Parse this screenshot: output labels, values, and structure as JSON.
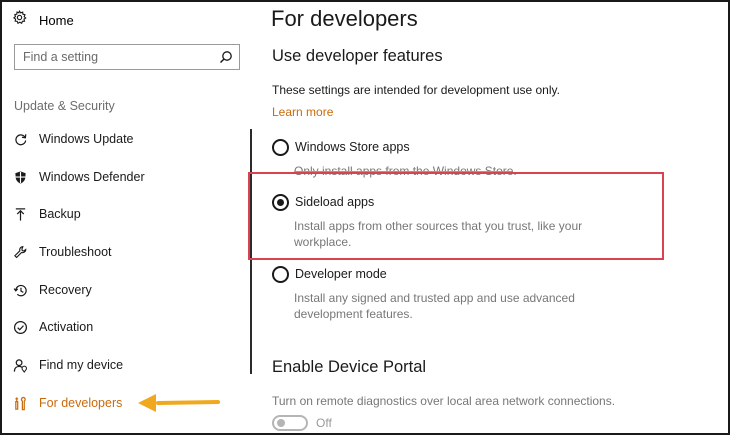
{
  "sidebar": {
    "home_label": "Home",
    "search_placeholder": "Find a setting",
    "section_label": "Update & Security",
    "items": [
      {
        "label": "Windows Update",
        "icon": "refresh-icon"
      },
      {
        "label": "Windows Defender",
        "icon": "shield-icon"
      },
      {
        "label": "Backup",
        "icon": "upload-icon"
      },
      {
        "label": "Troubleshoot",
        "icon": "wrench-icon"
      },
      {
        "label": "Recovery",
        "icon": "history-icon"
      },
      {
        "label": "Activation",
        "icon": "check-circle-icon"
      },
      {
        "label": "Find my device",
        "icon": "person-pin-icon"
      },
      {
        "label": "For developers",
        "icon": "developer-tools-icon",
        "active": true
      }
    ],
    "accent_color": "#c76b0d"
  },
  "main": {
    "title": "For developers",
    "developer_features": {
      "heading": "Use developer features",
      "description": "These settings are intended for development use only.",
      "learn_more": "Learn more",
      "options": [
        {
          "label": "Windows Store apps",
          "description": "Only install apps from the Windows Store.",
          "selected": false
        },
        {
          "label": "Sideload apps",
          "description_line1": "Install apps from other sources that you trust, like your",
          "description_line2": "workplace.",
          "selected": true
        },
        {
          "label": "Developer mode",
          "description_line1": "Install any signed and trusted app and use advanced",
          "description_line2": "development features.",
          "selected": false
        }
      ]
    },
    "device_portal": {
      "heading": "Enable Device Portal",
      "description": "Turn on remote diagnostics over local area network connections.",
      "toggle_state": "Off",
      "toggle_on": false
    }
  },
  "colors": {
    "highlight_border": "#d9434e",
    "annotation_arrow": "#f0a91e"
  }
}
